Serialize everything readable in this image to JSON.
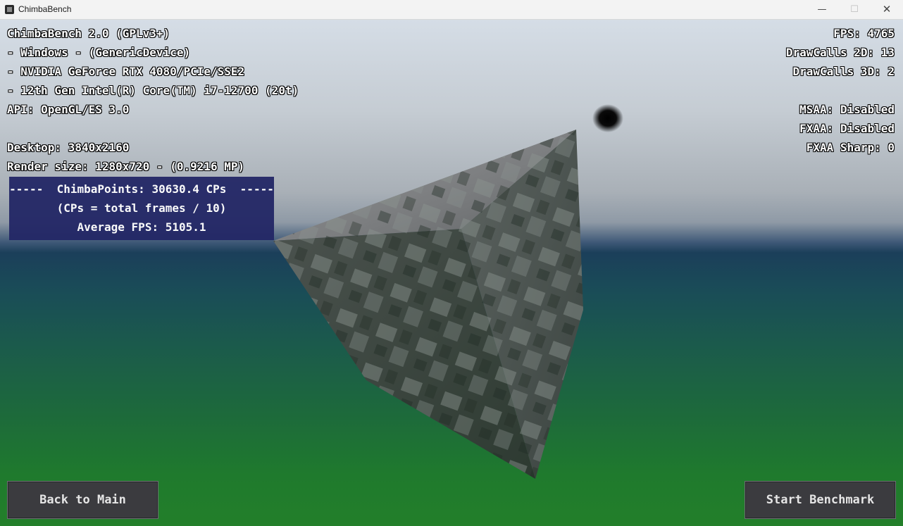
{
  "window": {
    "title": "ChimbaBench",
    "minimize_glyph": "—",
    "maximize_glyph": "☐",
    "close_glyph": "✕"
  },
  "hud_left": {
    "line1": "ChimbaBench 2.0 (GPLv3+)",
    "line2": "- Windows - (GenericDevice)",
    "line3": "- NVIDIA GeForce RTX 4080/PCIe/SSE2",
    "line4": "- 12th Gen Intel(R) Core(TM) i7-12700 (20t)",
    "line5": "API: OpenGL/ES 3.0",
    "line6": "Desktop: 3840x2160",
    "line7": "Render size: 1280x720 - (0.9216 MP)"
  },
  "hud_right": {
    "fps": "FPS: 4765",
    "drawcalls_2d": "DrawCalls 2D: 13",
    "drawcalls_3d": "DrawCalls 3D: 2",
    "msaa": "MSAA: Disabled",
    "fxaa": "FXAA: Disabled",
    "fxaa_sharp": "FXAA Sharp: 0"
  },
  "score": {
    "title": "-----  ChimbaPoints: 30630.4 CPs  -----",
    "formula": "(CPs = total frames / 10)",
    "average": "Average FPS: 5105.1"
  },
  "buttons": {
    "back": "Back to Main",
    "start": "Start Benchmark"
  },
  "icons": {
    "app": "chimbabench-app-icon"
  }
}
